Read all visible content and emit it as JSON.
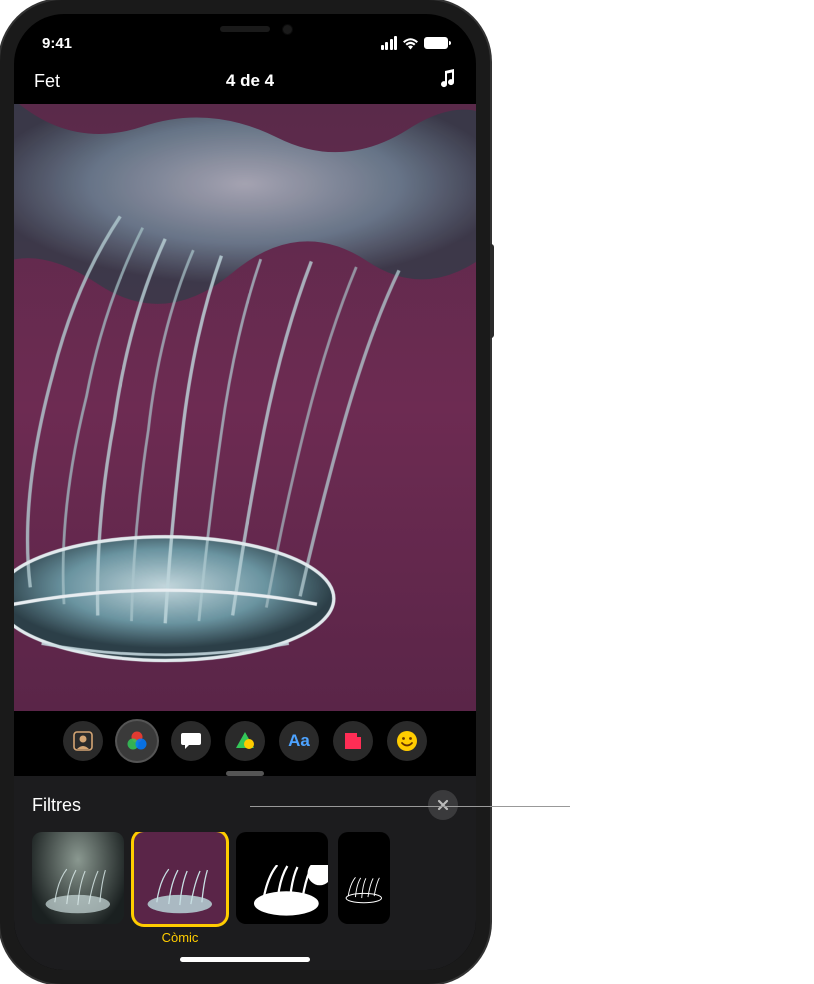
{
  "status_bar": {
    "time": "9:41"
  },
  "nav": {
    "done": "Fet",
    "title": "4 de 4"
  },
  "toolbar": {
    "items": [
      {
        "name": "memoji-button",
        "active": false
      },
      {
        "name": "filters-button",
        "active": true
      },
      {
        "name": "text-bubble-button",
        "active": false
      },
      {
        "name": "shapes-button",
        "active": false
      },
      {
        "name": "text-style-button",
        "active": false
      },
      {
        "name": "stickers-button",
        "active": false
      },
      {
        "name": "emoji-button",
        "active": false
      }
    ]
  },
  "filters_panel": {
    "title": "Filtres",
    "items": [
      {
        "label": "",
        "selected": false
      },
      {
        "label": "Còmic",
        "selected": true
      },
      {
        "label": "",
        "selected": false
      },
      {
        "label": "",
        "selected": false
      }
    ]
  }
}
